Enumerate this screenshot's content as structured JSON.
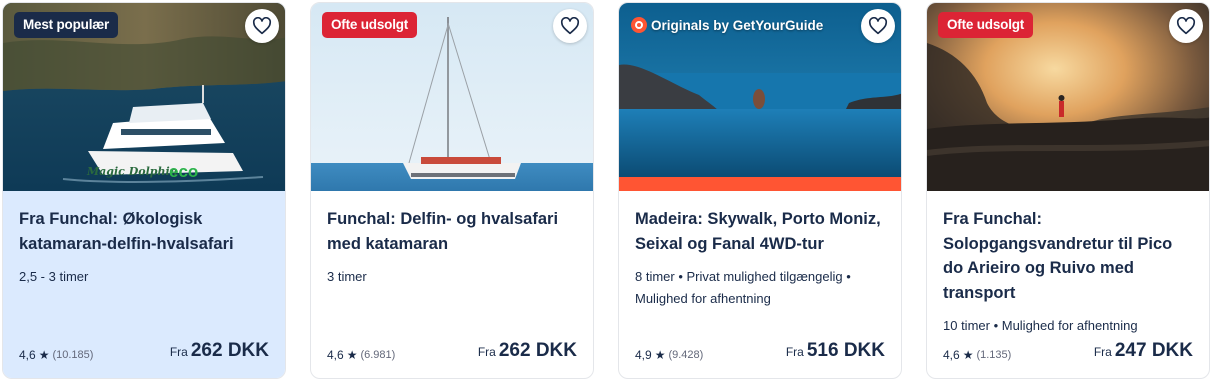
{
  "cards": [
    {
      "badge": "Mest populær",
      "title": "Fra Funchal: Økologisk katamaran-delfin-hvalsafari",
      "meta": "2,5 - 3 timer",
      "rating": "4,6",
      "reviews": "(10.185)",
      "from": "Fra",
      "price": "262 DKK",
      "boat_name": "Magic Dolphin",
      "boat_eco": "eco"
    },
    {
      "badge": "Ofte udsolgt",
      "title": "Funchal: Delfin- og hvalsafari med katamaran",
      "meta": "3 timer",
      "rating": "4,6",
      "reviews": "(6.981)",
      "from": "Fra",
      "price": "262 DKK"
    },
    {
      "badge": "Originals by GetYourGuide",
      "title": "Madeira: Skywalk, Porto Moniz, Seixal og Fanal 4WD-tur",
      "meta": "8 timer • Privat mulighed tilgængelig • Mulighed for afhentning",
      "rating": "4,9",
      "reviews": "(9.428)",
      "from": "Fra",
      "price": "516 DKK"
    },
    {
      "badge": "Ofte udsolgt",
      "title": "Fra Funchal: Solopgangsvandretur til Pico do Arieiro og Ruivo med transport",
      "meta": "10 timer • Mulighed for afhentning",
      "rating": "4,6",
      "reviews": "(1.135)",
      "from": "Fra",
      "price": "247 DKK"
    }
  ],
  "colors": {
    "navy": "#1a2b49",
    "badge_red": "#dc2435",
    "originals_orange": "#ff5533",
    "selected_card_bg": "#dbeafe"
  },
  "icons": {
    "wishlist": "heart-outline-icon",
    "rating": "star-icon",
    "originals": "getyourguide-logo"
  }
}
